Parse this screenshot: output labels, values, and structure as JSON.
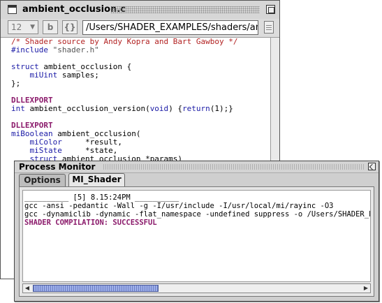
{
  "editor": {
    "title": "ambient_occlusion.c",
    "font_size": "12",
    "bold_label": "b",
    "brace_label": "{}",
    "path": "/Users/SHADER_EXAMPLES/shaders/ambient_occlusion.c",
    "lines": [
      [
        {
          "t": "/* Shader source by Andy Kopra and Bart Gawboy */",
          "c": "cmt"
        }
      ],
      [
        {
          "t": "#include ",
          "c": "kw"
        },
        {
          "t": "\"shader.h\"",
          "c": "str"
        }
      ],
      [],
      [
        {
          "t": "struct ",
          "c": "kw"
        },
        {
          "t": "ambient_occlusion {",
          "c": "fn"
        }
      ],
      [
        {
          "t": "    miUint ",
          "c": "typ"
        },
        {
          "t": "samples;",
          "c": "fn"
        }
      ],
      [
        {
          "t": "};",
          "c": "fn"
        }
      ],
      [],
      [
        {
          "t": "DLLEXPORT",
          "c": "mac"
        }
      ],
      [
        {
          "t": "int ",
          "c": "kw"
        },
        {
          "t": "ambient_occlusion_version(",
          "c": "fn"
        },
        {
          "t": "void",
          "c": "kw"
        },
        {
          "t": ") {",
          "c": "fn"
        },
        {
          "t": "return",
          "c": "kw"
        },
        {
          "t": "(1);}",
          "c": "fn"
        }
      ],
      [],
      [
        {
          "t": "DLLEXPORT",
          "c": "mac"
        }
      ],
      [
        {
          "t": "miBoolean ",
          "c": "typ"
        },
        {
          "t": "ambient_occlusion(",
          "c": "fn"
        }
      ],
      [
        {
          "t": "    miColor     ",
          "c": "typ"
        },
        {
          "t": "*result,",
          "c": "fn"
        }
      ],
      [
        {
          "t": "    miState     ",
          "c": "typ"
        },
        {
          "t": "*state,",
          "c": "fn"
        }
      ],
      [
        {
          "t": "    struct ",
          "c": "kw"
        },
        {
          "t": "ambient_occlusion *params)",
          "c": "fn"
        }
      ]
    ]
  },
  "monitor": {
    "title": "Process Monitor",
    "tabs": [
      {
        "label": "Options",
        "active": false
      },
      {
        "label": "MI_Shader",
        "active": true
      }
    ],
    "log_lines": [
      {
        "t": "__________ [5] 8.15:24PM __________",
        "c": ""
      },
      {
        "t": "gcc -ansi -pedantic -Wall -g -I/usr/include -I/usr/local/mi/rayinc -O3",
        "c": ""
      },
      {
        "t": "gcc -dynamiclib -dynamic -flat_namespace -undefined suppress -o /Users/SHADER_EXAMPLES",
        "c": ""
      },
      {
        "t": "SHADER COMPILATION: SUCCESSFUL",
        "c": "ok"
      }
    ],
    "hscroll_position": 0.0
  }
}
